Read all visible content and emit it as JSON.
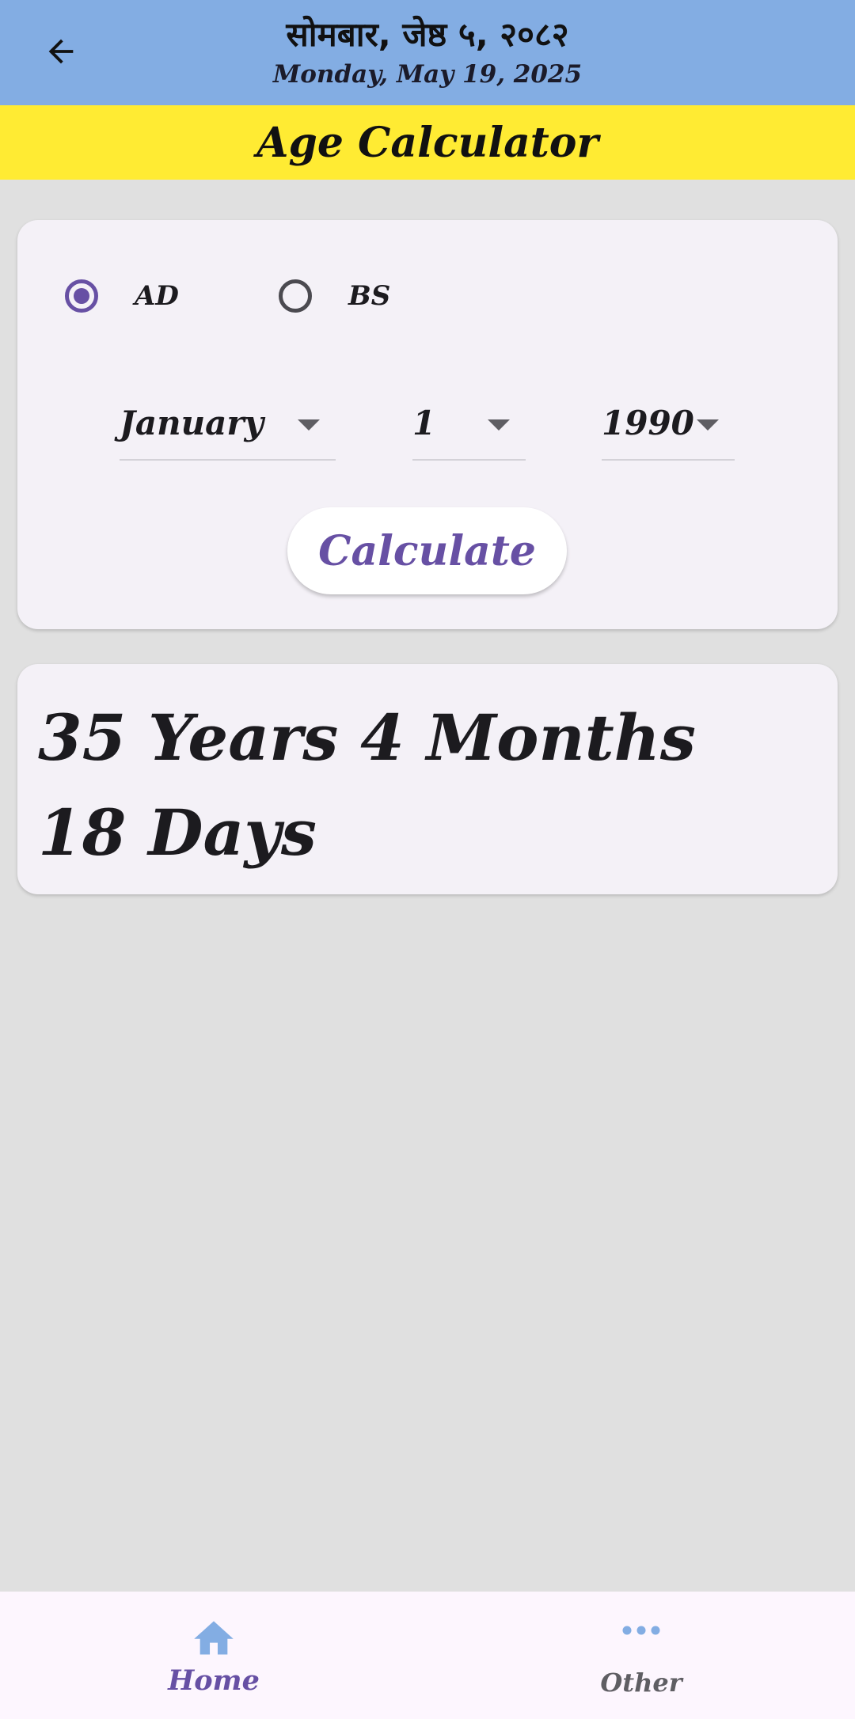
{
  "header": {
    "nepali_date": "सोमबार, जेष्ठ ५, २०८२",
    "english_date": "Monday, May 19, 2025",
    "back_icon": "arrow-left-icon",
    "background_color": "#83ade3"
  },
  "title_bar": {
    "title": "Age Calculator",
    "background_color": "#ffeb33"
  },
  "calendar_type": {
    "options": [
      {
        "label": "AD",
        "selected": true
      },
      {
        "label": "BS",
        "selected": false
      }
    ]
  },
  "date_picker": {
    "month": "January",
    "day": "1",
    "year": "1990"
  },
  "calculate_button": {
    "label": "Calculate",
    "text_color": "#6750a4"
  },
  "result": {
    "text": "35 Years 4 Months 18 Days"
  },
  "bottom_nav": {
    "items": [
      {
        "label": "Home",
        "icon": "home-icon",
        "selected": true
      },
      {
        "label": "Other",
        "icon": "more-horizontal-icon",
        "selected": false
      }
    ]
  },
  "colors": {
    "accent": "#6750a4",
    "nav_icon": "#83ade3",
    "page_background": "#e0e0e0",
    "card_background": "#f4f1f7"
  }
}
